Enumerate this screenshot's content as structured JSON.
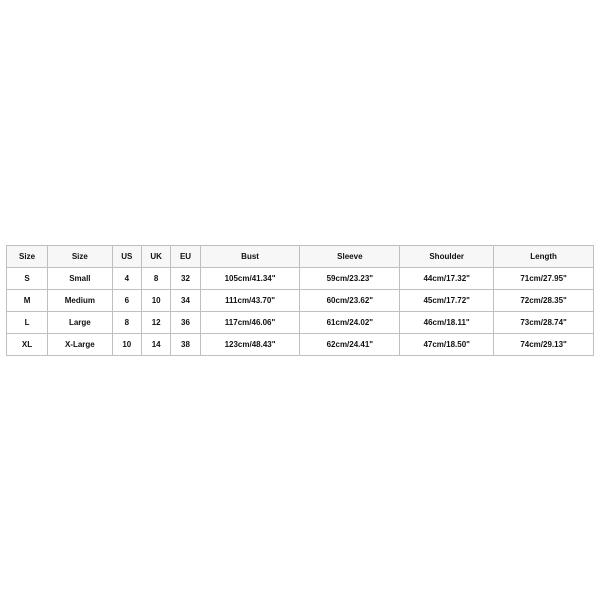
{
  "chart_data": {
    "type": "table",
    "headers": [
      "Size",
      "Size",
      "US",
      "UK",
      "EU",
      "Bust",
      "Sleeve",
      "Shoulder",
      "Length"
    ],
    "rows": [
      [
        "S",
        "Small",
        "4",
        "8",
        "32",
        "105cm/41.34\"",
        "59cm/23.23\"",
        "44cm/17.32\"",
        "71cm/27.95\""
      ],
      [
        "M",
        "Medium",
        "6",
        "10",
        "34",
        "111cm/43.70\"",
        "60cm/23.62\"",
        "45cm/17.72\"",
        "72cm/28.35\""
      ],
      [
        "L",
        "Large",
        "8",
        "12",
        "36",
        "117cm/46.06\"",
        "61cm/24.02\"",
        "46cm/18.11\"",
        "73cm/28.74\""
      ],
      [
        "XL",
        "X-Large",
        "10",
        "14",
        "38",
        "123cm/48.43\"",
        "62cm/24.41\"",
        "47cm/18.50\"",
        "74cm/29.13\""
      ]
    ]
  }
}
